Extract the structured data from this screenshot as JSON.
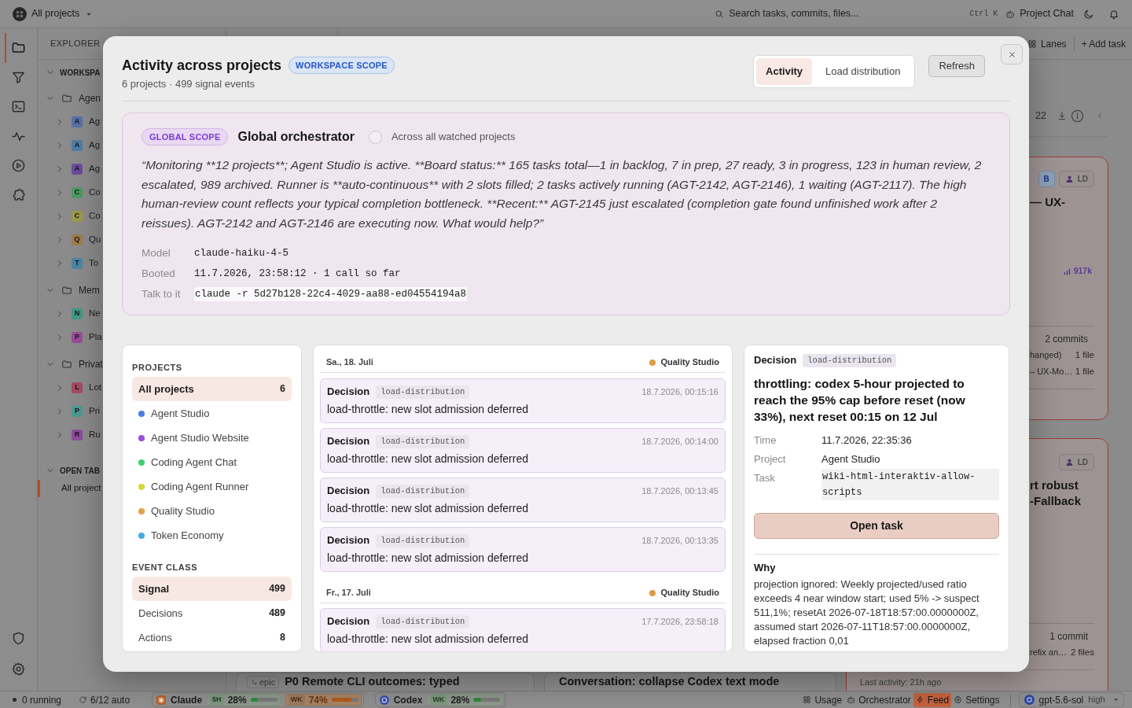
{
  "top_bar": {
    "workspace": "All projects",
    "search": {
      "placeholder": "Search tasks, commits, files..."
    },
    "shortcut": "Ctrl K",
    "chat_button": "Project Chat"
  },
  "rail": {
    "top_items": [
      {
        "selected": true
      },
      {
        "selected": false
      },
      {
        "selected": false
      },
      {
        "selected": false
      },
      {
        "selected": false
      },
      {
        "selected": false
      }
    ],
    "bottom_items": [
      {
        "selected": false
      },
      {
        "selected": false
      }
    ]
  },
  "explorer": {
    "title": "EXPLORER",
    "sections": [
      {
        "kind": "section",
        "label": "WORKSPA",
        "expanded": true,
        "children": [
          {
            "kind": "folder",
            "label": "Agen",
            "expanded": true,
            "children": [
              {
                "kind": "project",
                "badge": "A",
                "label": "Ag",
                "color": "#5570a8",
                "expanded": false
              },
              {
                "kind": "project",
                "badge": "A",
                "label": "Ag",
                "color": "#4e7ea6",
                "expanded": false
              },
              {
                "kind": "project",
                "badge": "A",
                "label": "Ag",
                "color": "#6c4c9c",
                "expanded": false
              },
              {
                "kind": "project",
                "badge": "C",
                "label": "Co",
                "color": "#4c9a62",
                "expanded": false
              },
              {
                "kind": "project",
                "badge": "C",
                "label": "Co",
                "color": "#9c9a48",
                "expanded": false
              },
              {
                "kind": "project",
                "badge": "Q",
                "label": "Qu",
                "color": "#a27c4a",
                "expanded": false
              },
              {
                "kind": "project",
                "badge": "T",
                "label": "To",
                "color": "#4c84a6",
                "expanded": false
              }
            ]
          },
          {
            "kind": "folder",
            "label": "Mem",
            "expanded": true,
            "children": [
              {
                "kind": "project",
                "badge": "N",
                "label": "Ne",
                "color": "#3f9a84",
                "expanded": false
              },
              {
                "kind": "project",
                "badge": "P",
                "label": "Pla",
                "color": "#9a4c9a",
                "expanded": false
              }
            ]
          },
          {
            "kind": "folder",
            "label": "Privat",
            "expanded": true,
            "children": [
              {
                "kind": "project",
                "badge": "L",
                "label": "Lot",
                "color": "#a44c64",
                "expanded": false
              },
              {
                "kind": "project",
                "badge": "P",
                "label": "Pri",
                "color": "#4c9a8e",
                "expanded": false
              },
              {
                "kind": "project",
                "badge": "R",
                "label": "Ru",
                "color": "#8e4c9e",
                "expanded": false
              }
            ]
          }
        ]
      },
      {
        "kind": "section",
        "label": "OPEN TAB",
        "expanded": true,
        "children": [
          {
            "kind": "tab",
            "label": "All project",
            "selected": true
          }
        ]
      }
    ]
  },
  "board": {
    "toolbar": {
      "view_button": "Lanes",
      "add_button": "+ Add task"
    },
    "lanes": [
      {
        "cards": [
          {
            "tag": "epic",
            "title": "P0 Remote CLI outcomes: typed"
          }
        ]
      },
      {
        "cards": [
          {
            "title": "Conversation: collapse Codex text mode"
          }
        ]
      },
      {
        "count": "22",
        "cards": [
          {
            "badges": [
              {
                "kind": "letter",
                "text": "B"
              },
              {
                "kind": "assignee",
                "text": "LD"
              }
            ],
            "title_lines": [
              "— UX-"
            ],
            "tokens": "917k",
            "commits": "2 commits",
            "files": [
              {
                "name": "hanged)",
                "count": "1 file"
              },
              {
                "name": "– UX-Mo…",
                "count": "1 file"
              }
            ]
          },
          {
            "badges": [
              {
                "kind": "assignee",
                "text": "LD"
              }
            ],
            "title_lines": [
              "rt robust",
              "-Fallback"
            ],
            "commits": "1 commit",
            "files": [
              {
                "name": "refix an…",
                "count": "2 files"
              }
            ],
            "last_activity": "Last activity: 21h ago"
          }
        ]
      }
    ]
  },
  "modal": {
    "title": "Activity across projects",
    "scope_badge": "WORKSPACE SCOPE",
    "subtitle": "6 projects · 499 signal events",
    "tabs": [
      {
        "label": "Activity",
        "selected": true
      },
      {
        "label": "Load distribution",
        "selected": false
      }
    ],
    "refresh_button": "Refresh",
    "orchestrator": {
      "scope_badge": "GLOBAL SCOPE",
      "title": "Global orchestrator",
      "watch_all": {
        "label": "Across all watched projects",
        "checked": false
      },
      "message": "“Monitoring **12 projects**; Agent Studio is active. **Board status:** 165 tasks total—1 in backlog, 7 in prep, 27 ready, 3 in progress, 123 in human review, 2 escalated, 989 archived. Runner is **auto-continuous** with 2 slots filled; 2 tasks actively running (AGT-2142, AGT-2146), 1 waiting (AGT-2117). The high human-review count reflects your typical completion bottleneck. **Recent:** AGT-2145 just escalated (completion gate found unfinished work after 2 reissues). AGT-2142 and AGT-2146 are executing now. What would help?”",
      "details": [
        {
          "kind": "text",
          "label": "Model",
          "value": "claude-haiku-4-5"
        },
        {
          "kind": "text",
          "label": "Booted",
          "value": "11.7.2026, 23:58:12 · 1 call so far"
        },
        {
          "kind": "command",
          "label": "Talk to it",
          "value": "claude -r 5d27b128-22c4-4029-aa88-ed04554194a8"
        }
      ]
    },
    "filters": {
      "projects_heading": "PROJECTS",
      "projects": [
        {
          "label": "All projects",
          "count": "6",
          "selected": true
        },
        {
          "label": "Agent Studio",
          "color": "#4a7de0",
          "selected": false
        },
        {
          "label": "Agent Studio Website",
          "color": "#9b4ce0",
          "selected": false
        },
        {
          "label": "Coding Agent Chat",
          "color": "#3fd072",
          "selected": false
        },
        {
          "label": "Coding Agent Runner",
          "color": "#d6d93c",
          "selected": false
        },
        {
          "label": "Quality Studio",
          "color": "#e3a04a",
          "selected": false
        },
        {
          "label": "Token Economy",
          "color": "#44ade0",
          "selected": false
        }
      ],
      "event_class_heading": "EVENT CLASS",
      "event_classes": [
        {
          "label": "Signal",
          "count": "499",
          "selected": true
        },
        {
          "label": "Decisions",
          "count": "489",
          "selected": false
        },
        {
          "label": "Actions",
          "count": "8",
          "selected": false
        }
      ]
    },
    "feed": {
      "groups": [
        {
          "date": "Sa., 18. Juli",
          "project": "Quality Studio",
          "color": "#e09b45",
          "events": [
            {
              "type": "Decision",
              "tag": "load-distribution",
              "time": "18.7.2026, 00:15:16",
              "text": "load-throttle: new slot admission deferred"
            },
            {
              "type": "Decision",
              "tag": "load-distribution",
              "time": "18.7.2026, 00:14:00",
              "text": "load-throttle: new slot admission deferred"
            },
            {
              "type": "Decision",
              "tag": "load-distribution",
              "time": "18.7.2026, 00:13:45",
              "text": "load-throttle: new slot admission deferred"
            },
            {
              "type": "Decision",
              "tag": "load-distribution",
              "time": "18.7.2026, 00:13:35",
              "text": "load-throttle: new slot admission deferred"
            }
          ]
        },
        {
          "date": "Fr., 17. Juli",
          "project": "Quality Studio",
          "color": "#e09b45",
          "events": [
            {
              "type": "Decision",
              "tag": "load-distribution",
              "time": "17.7.2026, 23:58:18",
              "text": "load-throttle: new slot admission deferred"
            }
          ]
        }
      ]
    },
    "detail": {
      "type": "Decision",
      "tag": "load-distribution",
      "title": "throttling: codex 5-hour projected to reach the 95% cap before reset (now 33%), next reset 00:15 on 12 Jul",
      "fields": [
        {
          "kind": "text",
          "label": "Time",
          "value": "11.7.2026, 22:35:36"
        },
        {
          "kind": "text",
          "label": "Project",
          "value": "Agent Studio"
        },
        {
          "kind": "code",
          "label": "Task",
          "value": "wiki-html-interaktiv-allow-scripts"
        }
      ],
      "open_button": "Open task",
      "why_heading": "Why",
      "why_text": "projection ignored: Weekly projected/used ratio exceeds 4 near window start; used 5% -> suspect 511,1%; resetAt 2026-07-18T18:57:00.0000000Z, assumed start 2026-07-11T18:57:00.0000000Z, elapsed fraction 0,01"
    }
  },
  "status_bar": {
    "running": "0 running",
    "auto": "6/12 auto",
    "providers": [
      {
        "name": "Claude",
        "meters": [
          {
            "label": "5H",
            "reading": "28%",
            "level": 0.28
          },
          {
            "label": "WK",
            "reading": "74%",
            "level": 0.74
          }
        ]
      },
      {
        "name": "Codex",
        "meters": [
          {
            "label": "WK",
            "reading": "28%",
            "level": 0.28
          }
        ]
      }
    ],
    "links": [
      {
        "label": "Usage",
        "selected": false
      },
      {
        "label": "Orchestrator",
        "selected": false
      },
      {
        "label": "Feed",
        "selected": true
      },
      {
        "label": "Settings",
        "selected": false
      }
    ],
    "model": {
      "name": "gpt-5.6-sol",
      "effort": "high"
    }
  }
}
